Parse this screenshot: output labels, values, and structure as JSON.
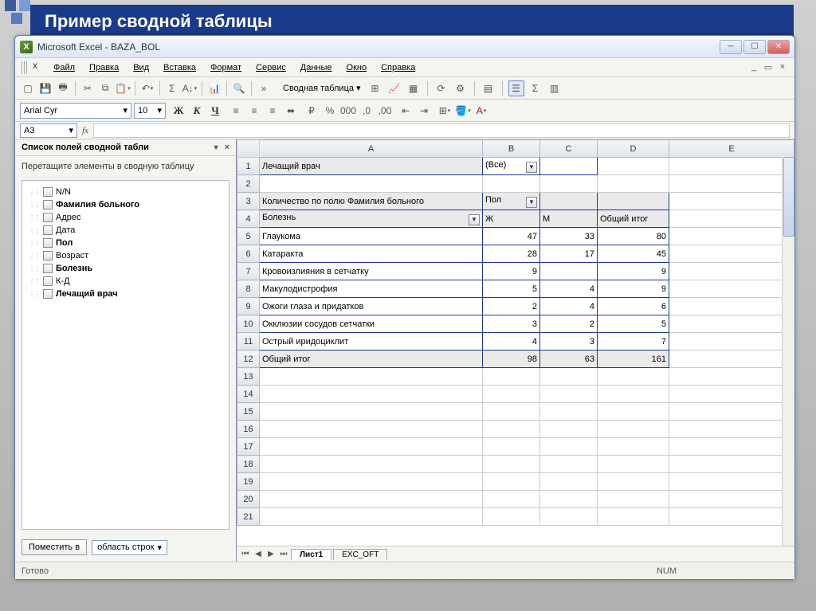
{
  "slide_title": "Пример сводной таблицы",
  "window_title": "Microsoft Excel - BAZA_BOL",
  "menu": [
    "Файл",
    "Правка",
    "Вид",
    "Вставка",
    "Формат",
    "Сервис",
    "Данные",
    "Окно",
    "Справка"
  ],
  "pivot_toolbar_label": "Сводная таблица",
  "font": {
    "name": "Arial Cyr",
    "size": "10"
  },
  "namebox": "A3",
  "taskpane": {
    "title": "Список полей сводной табли",
    "hint": "Перетащите элементы в сводную таблицу",
    "fields": [
      {
        "label": "N/N",
        "bold": false
      },
      {
        "label": "Фамилия больного",
        "bold": true
      },
      {
        "label": "Адрес",
        "bold": false
      },
      {
        "label": "Дата",
        "bold": false
      },
      {
        "label": "Пол",
        "bold": true
      },
      {
        "label": "Возраст",
        "bold": false
      },
      {
        "label": "Болезнь",
        "bold": true
      },
      {
        "label": "К-Д",
        "bold": false
      },
      {
        "label": "Лечащий врач",
        "bold": true
      }
    ],
    "place_btn": "Поместить в",
    "place_area": "область строк"
  },
  "columns": [
    "A",
    "B",
    "C",
    "D",
    "E"
  ],
  "pivot": {
    "page_field": "Лечащий врач",
    "page_value": "(Все)",
    "data_field": "Количество по полю Фамилия больного",
    "col_field": "Пол",
    "row_field": "Болезнь",
    "col_headers": [
      "Ж",
      "М",
      "Общий итог"
    ],
    "rows": [
      {
        "label": "Глаукома",
        "vals": [
          "47",
          "33",
          "80"
        ]
      },
      {
        "label": "Катаракта",
        "vals": [
          "28",
          "17",
          "45"
        ]
      },
      {
        "label": "Кровоизлияния в сетчатку",
        "vals": [
          "9",
          "",
          "9"
        ]
      },
      {
        "label": "Макулодистрофия",
        "vals": [
          "5",
          "4",
          "9"
        ]
      },
      {
        "label": "Ожоги глаза и придатков",
        "vals": [
          "2",
          "4",
          "6"
        ]
      },
      {
        "label": "Окклюзии сосудов сетчатки",
        "vals": [
          "3",
          "2",
          "5"
        ]
      },
      {
        "label": "Острый иридоциклит",
        "vals": [
          "4",
          "3",
          "7"
        ]
      }
    ],
    "total_label": "Общий итог",
    "totals": [
      "98",
      "63",
      "161"
    ]
  },
  "tabs": [
    "Лист1",
    "EXC_OFT"
  ],
  "status": {
    "ready": "Готово",
    "indicator": "NUM"
  }
}
